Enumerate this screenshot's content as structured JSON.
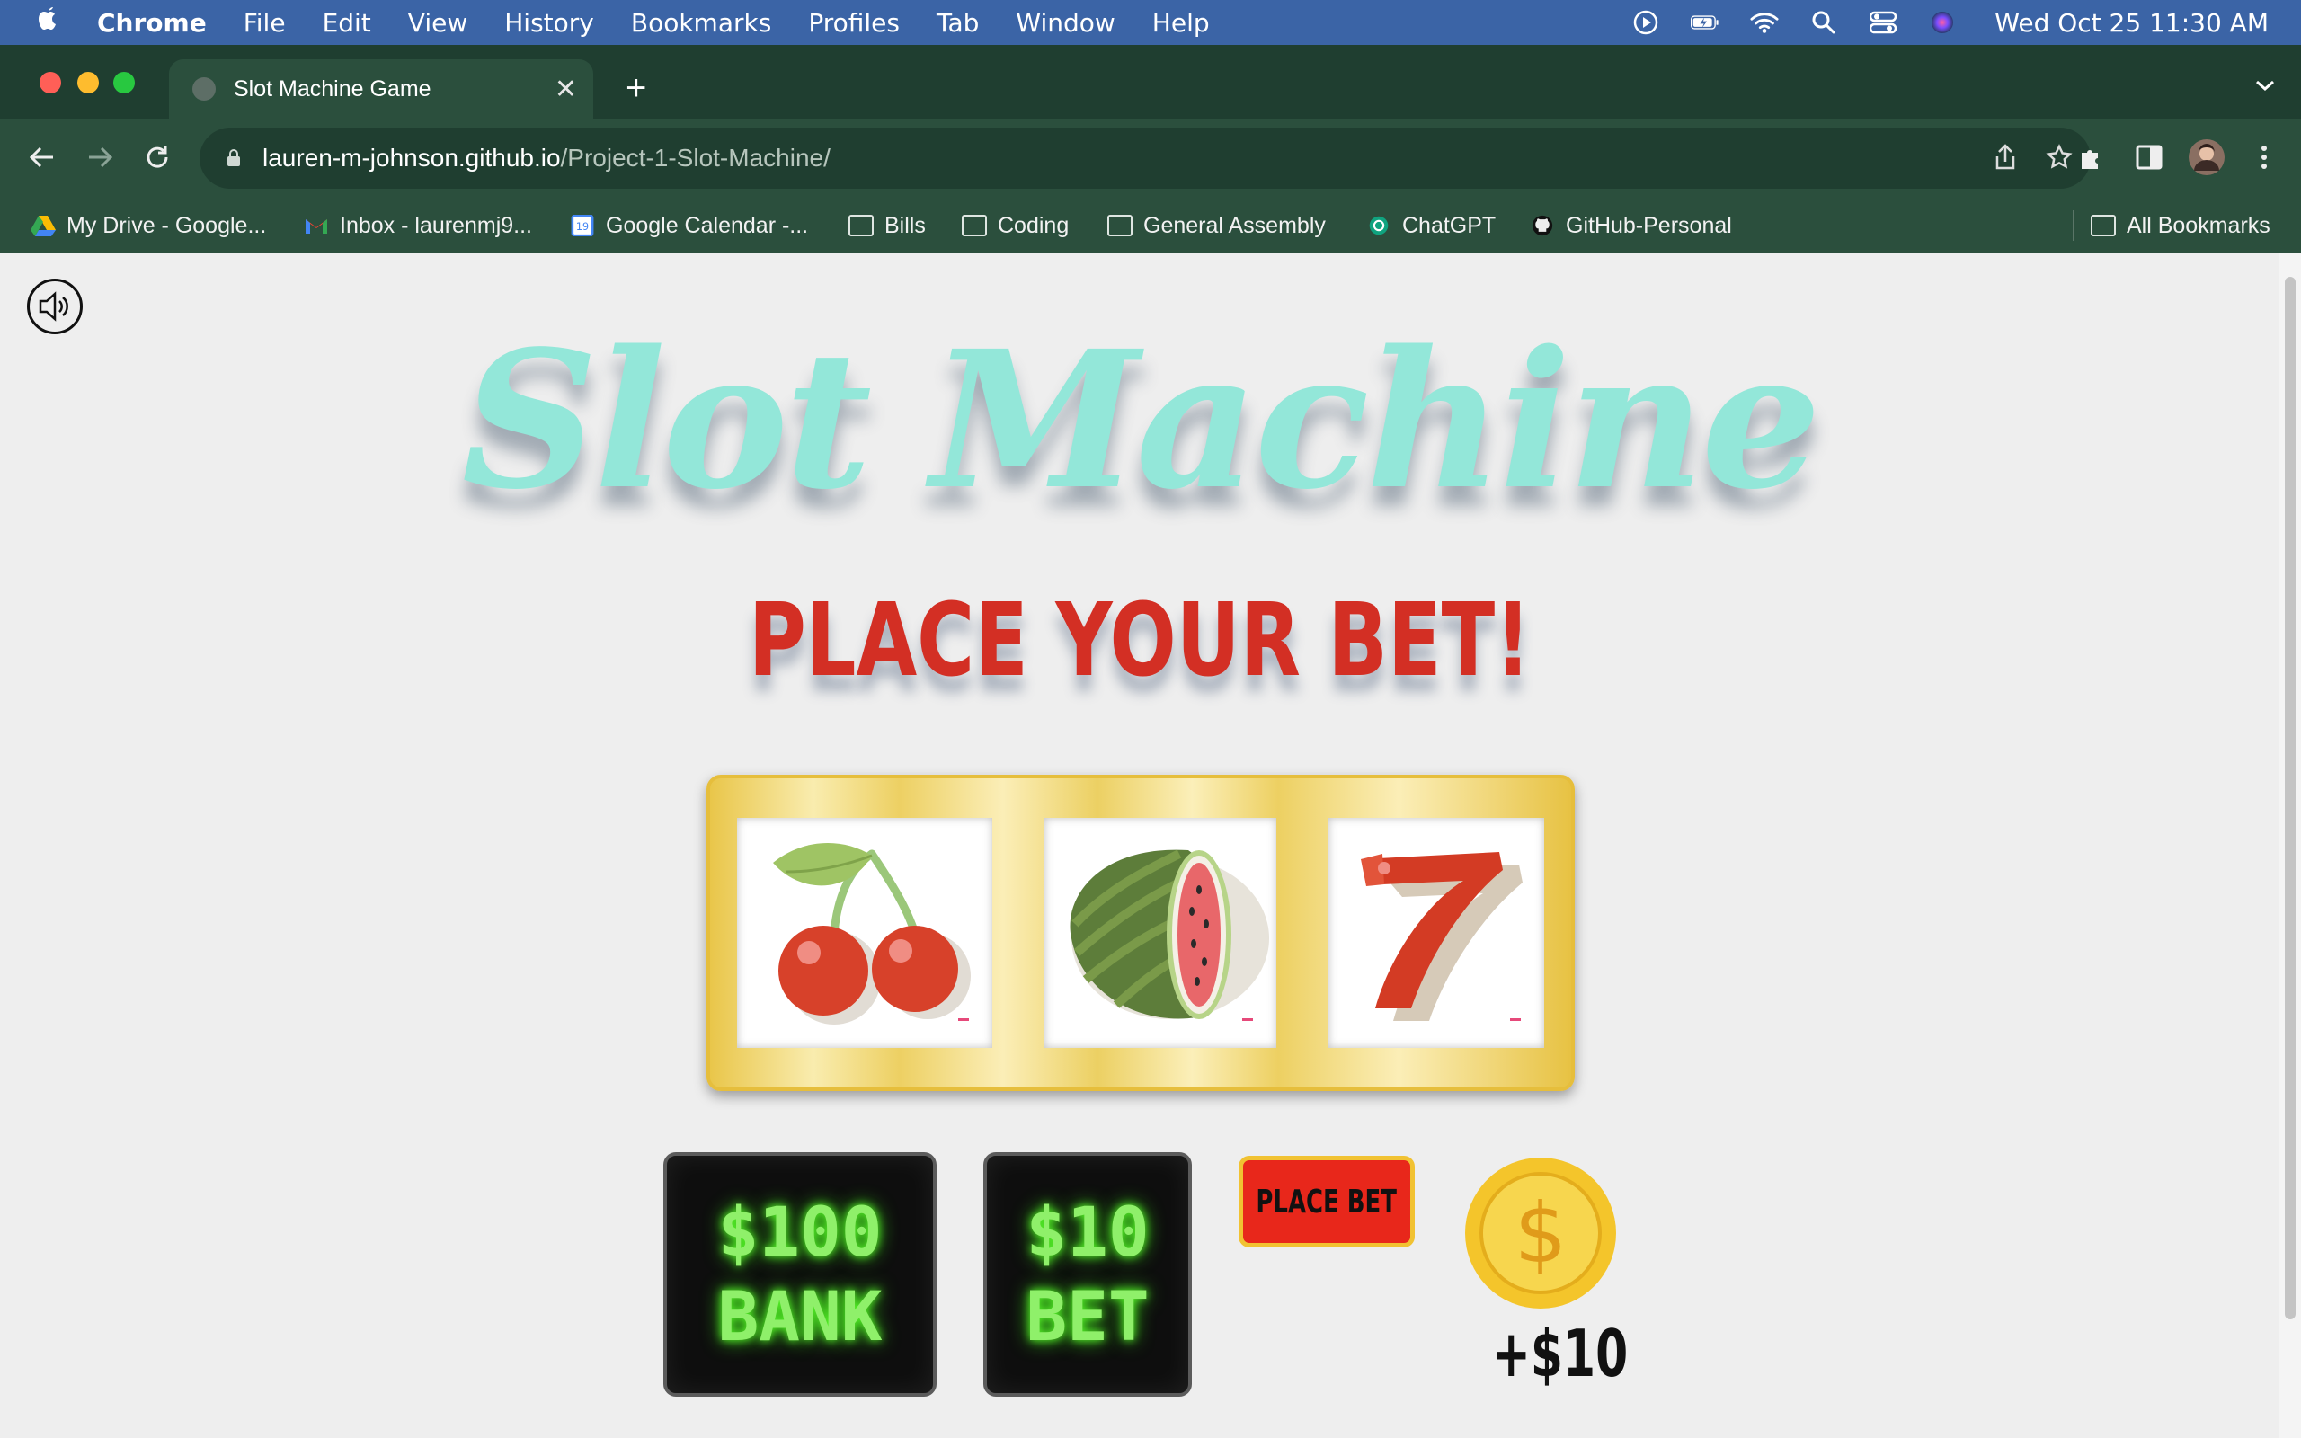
{
  "menubar": {
    "app": "Chrome",
    "items": [
      "File",
      "Edit",
      "View",
      "History",
      "Bookmarks",
      "Profiles",
      "Tab",
      "Window",
      "Help"
    ],
    "clock": "Wed Oct 25  11:30 AM",
    "status_icons": [
      "play-icon",
      "battery-icon",
      "wifi-icon",
      "search-icon",
      "control-center-icon",
      "siri-icon"
    ]
  },
  "browser": {
    "tab_title": "Slot Machine Game",
    "url_host": "lauren-m-johnson.github.io",
    "url_path": "/Project-1-Slot-Machine/",
    "bookmarks": [
      "My Drive - Google...",
      "Inbox - laurenmj9...",
      "Google Calendar -...",
      "Bills",
      "Coding",
      "General Assembly",
      "ChatGPT",
      "GitHub-Personal"
    ],
    "all_bookmarks": "All Bookmarks",
    "calendar_day": "19"
  },
  "game": {
    "title": "Slot Machine",
    "message": "PLACE YOUR BET!",
    "reels": [
      "cherry-icon",
      "watermelon-icon",
      "seven-icon"
    ],
    "bank_amount": "$100",
    "bank_label": "BANK",
    "bet_amount": "$10",
    "bet_label": "BET",
    "place_bet_label": "PLACE BET",
    "coin_symbol": "$",
    "winnings": "+$10"
  },
  "colors": {
    "menubar": "#3b64a6",
    "chrome_frame": "#1f3e30",
    "chrome_toolbar": "#2b4f3d",
    "title": "#93e7d9",
    "headline": "#d32f24",
    "neon": "#8ff06a",
    "place_bet_bg": "#e8271b",
    "coin": "#f4c52b"
  }
}
